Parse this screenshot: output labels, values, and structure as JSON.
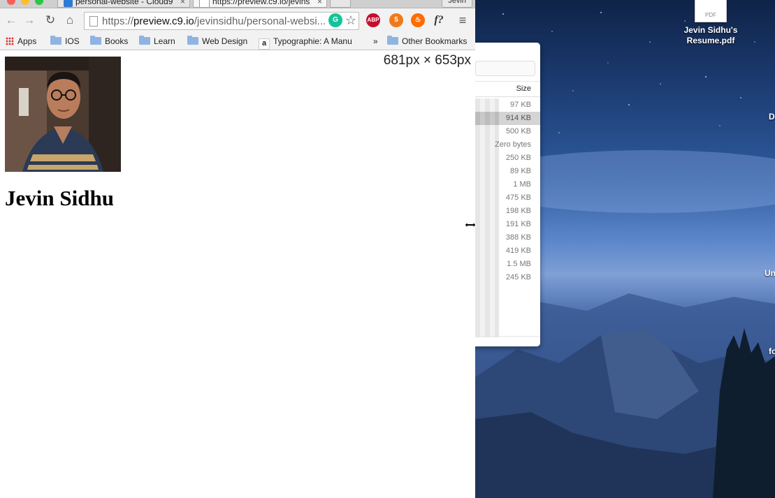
{
  "browser": {
    "tabs": [
      {
        "title": "personal-website - Cloud9",
        "active": false
      },
      {
        "title": "https://preview.c9.io/jevins",
        "active": true
      }
    ],
    "user_label": "Jevin",
    "url_host": "preview.c9.io",
    "url_prefix": "https://",
    "url_path": "/jevinsidhu/personal-websi...",
    "extensions": [
      {
        "name": "grammarly-icon",
        "label": "G",
        "color": "#15c39a"
      },
      {
        "name": "adblock-icon",
        "label": "ABP",
        "color": "#c70d2c"
      },
      {
        "name": "sync-icon",
        "label": "5",
        "color": "#f07a1a"
      },
      {
        "name": "fire-icon",
        "label": "",
        "color": "#ff6d00"
      },
      {
        "name": "font-icon",
        "label": "f?",
        "color": "#333333"
      }
    ]
  },
  "bookmarks": {
    "items": [
      {
        "label": "Apps",
        "icon": "apps-icon"
      },
      {
        "label": "IOS",
        "icon": "folder-icon"
      },
      {
        "label": "Books",
        "icon": "folder-icon"
      },
      {
        "label": "Learn",
        "icon": "folder-icon"
      },
      {
        "label": "Web Design",
        "icon": "folder-icon"
      },
      {
        "label": "Typographie: A Manu",
        "icon": "amazon-icon"
      }
    ],
    "overflow": "»",
    "other": "Other Bookmarks"
  },
  "page": {
    "dimensions": "681px × 653px",
    "heading": "Jevin Sidhu"
  },
  "finder": {
    "column_header": "Size",
    "sizes": [
      "97 KB",
      "914 KB",
      "500 KB",
      "Zero bytes",
      "250 KB",
      "89 KB",
      "1 MB",
      "475 KB",
      "198 KB",
      "191 KB",
      "388 KB",
      "419 KB",
      "1.5 MB",
      "245 KB"
    ],
    "selected_index": 1
  },
  "desktop": {
    "file_label_line1": "Jevin Sidhu's",
    "file_label_line2": "Resume.pdf",
    "pdf_badge": "PDF",
    "edge_labels": [
      "D",
      "Un",
      "fo"
    ]
  }
}
